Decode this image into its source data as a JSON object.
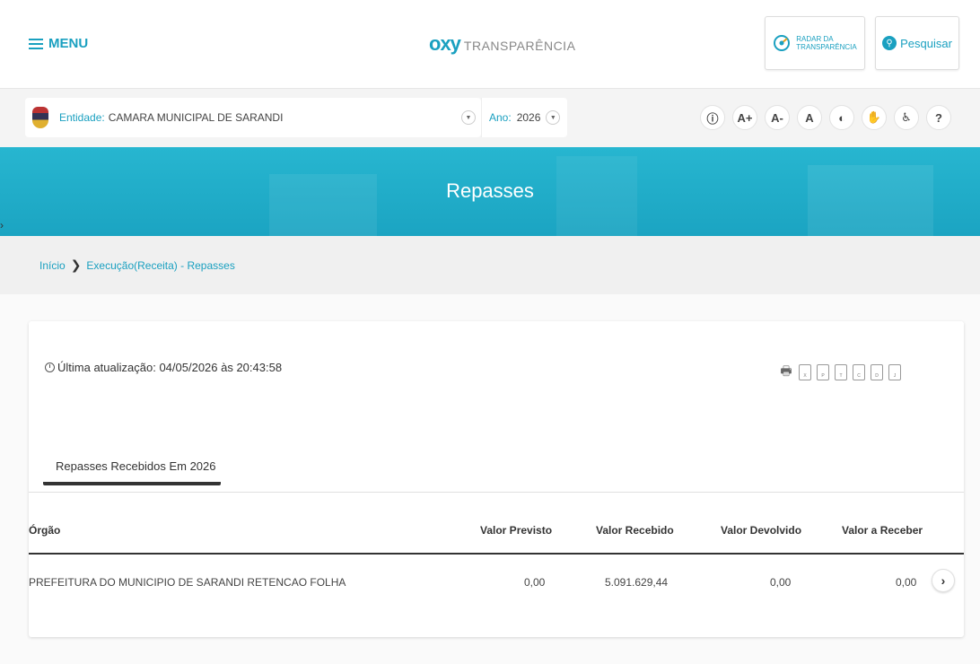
{
  "header": {
    "menu_label": "MENU",
    "brand_oxy": "oxy",
    "brand_transparencia": "TRANSPARÊNCIA",
    "radar_line1": "RADAR DA",
    "radar_line2": "TRANSPARÊNCIA",
    "search_label": "Pesquisar"
  },
  "entity": {
    "label": "Entidade:",
    "value": "CAMARA MUNICIPAL DE SARANDI",
    "year_label": "Ano:",
    "year_value": "2026"
  },
  "accessibility": [
    "A+",
    "A-",
    "A",
    "?"
  ],
  "banner": {
    "title": "Repasses"
  },
  "breadcrumb": {
    "home": "Início",
    "current": "Execução(Receita) - Repasses"
  },
  "card": {
    "updated_text": "Última atualização: 04/05/2026 às 20:43:58",
    "tab_label": "Repasses Recebidos Em 2026",
    "columns": [
      "Órgão",
      "Valor Previsto",
      "Valor Recebido",
      "Valor Devolvido",
      "Valor a Receber"
    ],
    "rows": [
      {
        "orgao": "PREFEITURA DO MUNICIPIO DE SARANDI RETENCAO FOLHA",
        "previsto": "0,00",
        "recebido": "5.091.629,44",
        "devolvido": "0,00",
        "a_receber": "0,00"
      }
    ]
  },
  "colors": {
    "accent": "#1aa0c0",
    "banner": "#1ba4c2"
  }
}
